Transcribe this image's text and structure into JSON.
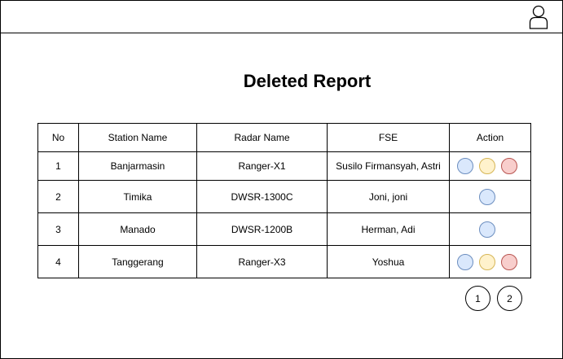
{
  "page": {
    "title": "Deleted Report"
  },
  "header": {
    "user_icon": "user-icon"
  },
  "table": {
    "columns": [
      "No",
      "Station Name",
      "Radar Name",
      "FSE",
      "Action"
    ],
    "rows": [
      {
        "no": "1",
        "station": "Banjarmasin",
        "radar": "Ranger-X1",
        "fse": "Susilo Firmansyah, Astri",
        "actions": [
          "blue",
          "yellow",
          "red"
        ]
      },
      {
        "no": "2",
        "station": "Timika",
        "radar": "DWSR-1300C",
        "fse": "Joni, joni",
        "actions": [
          "blue"
        ]
      },
      {
        "no": "3",
        "station": "Manado",
        "radar": "DWSR-1200B",
        "fse": "Herman, Adi",
        "actions": [
          "blue"
        ]
      },
      {
        "no": "4",
        "station": "Tanggerang",
        "radar": "Ranger-X3",
        "fse": "Yoshua",
        "actions": [
          "blue",
          "yellow",
          "red"
        ]
      }
    ]
  },
  "pagination": {
    "pages": [
      "1",
      "2"
    ]
  },
  "colors": {
    "action_blue_fill": "#dae8fc",
    "action_blue_stroke": "#6c8ebf",
    "action_yellow_fill": "#fff2cc",
    "action_yellow_stroke": "#d6b656",
    "action_red_fill": "#f8cecc",
    "action_red_stroke": "#b85450"
  }
}
